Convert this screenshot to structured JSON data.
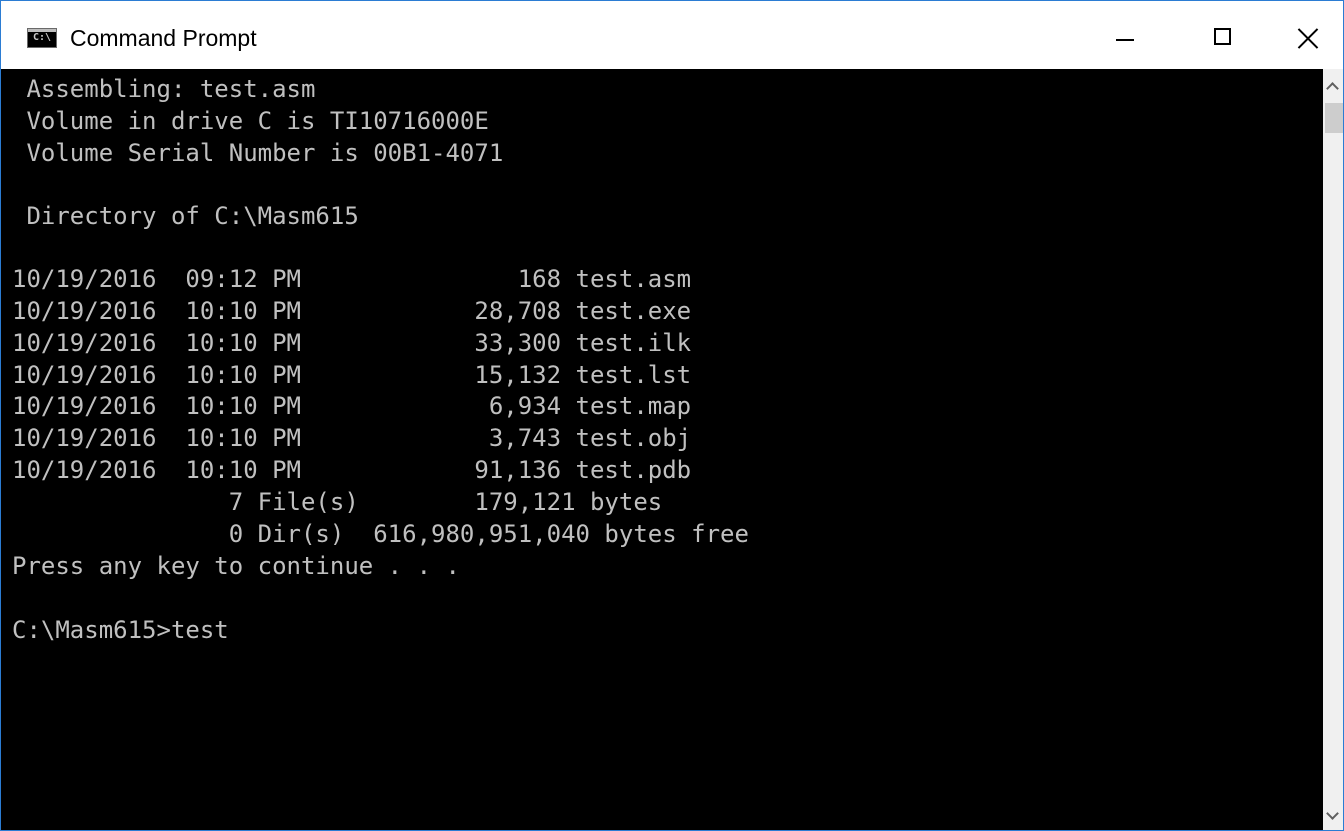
{
  "window": {
    "title": "Command Prompt",
    "icon_text": "C:\\",
    "icon": "cmd-icon"
  },
  "controls": {
    "minimize_icon": "minimize-icon",
    "maximize_icon": "maximize-icon",
    "close_icon": "close-icon"
  },
  "console": {
    "lines": [
      " Assembling: test.asm",
      " Volume in drive C is TI10716000E",
      " Volume Serial Number is 00B1-4071",
      "",
      " Directory of C:\\Masm615",
      "",
      "10/19/2016  09:12 PM               168 test.asm",
      "10/19/2016  10:10 PM            28,708 test.exe",
      "10/19/2016  10:10 PM            33,300 test.ilk",
      "10/19/2016  10:10 PM            15,132 test.lst",
      "10/19/2016  10:10 PM             6,934 test.map",
      "10/19/2016  10:10 PM             3,743 test.obj",
      "10/19/2016  10:10 PM            91,136 test.pdb",
      "               7 File(s)        179,121 bytes",
      "               0 Dir(s)  616,980,951,040 bytes free",
      "Press any key to continue . . .",
      "",
      "C:\\Masm615>test"
    ]
  },
  "colors": {
    "console_background": "#000000",
    "console_text": "#c0c0c0",
    "titlebar_background": "#ffffff",
    "window_border": "#2b7cd3"
  },
  "scrollbar": {
    "up_icon": "chevron-up-icon",
    "down_icon": "chevron-down-icon"
  }
}
